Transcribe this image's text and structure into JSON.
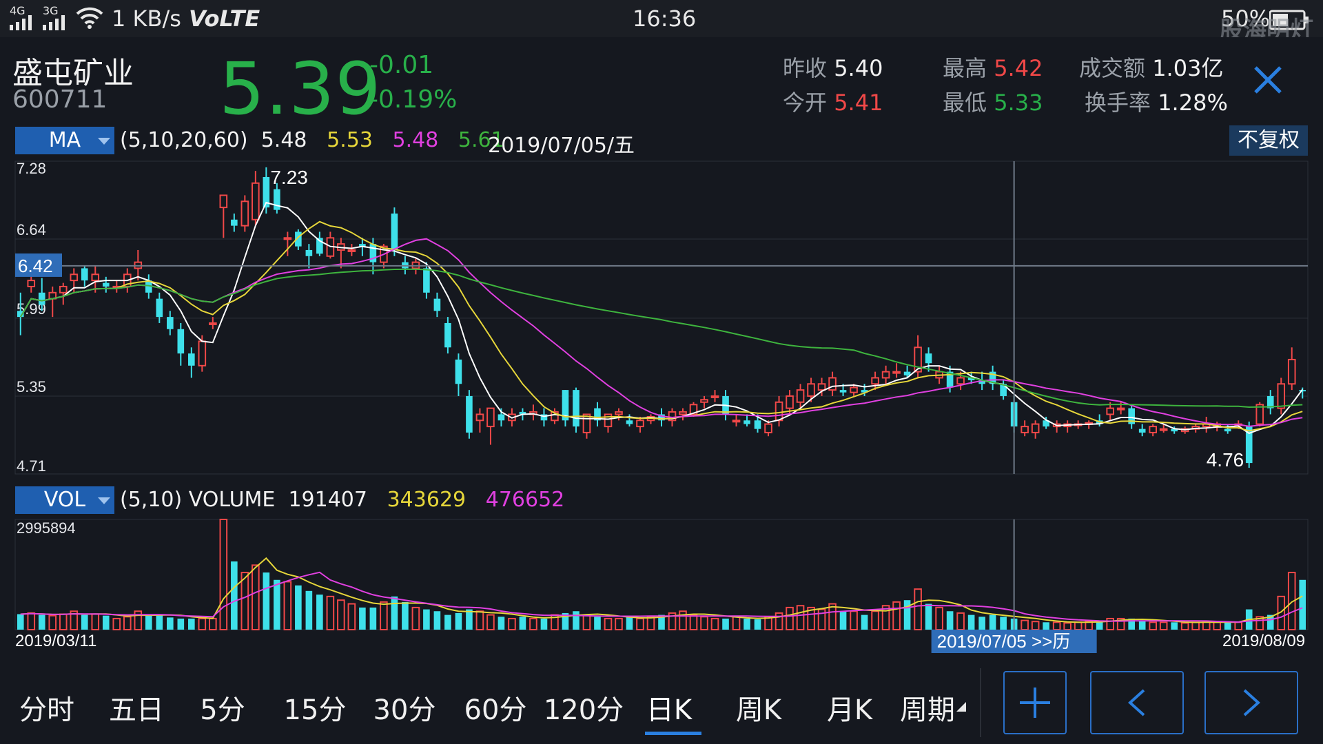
{
  "statusbar": {
    "signal1": "4G",
    "signal2": "3G",
    "speed": "1 KB/s",
    "volte": "VoLTE",
    "time": "16:36",
    "battery": "50%",
    "watermark": "股海明灯"
  },
  "stock": {
    "name": "盛屯矿业",
    "code": "600711",
    "price": "5.39",
    "change": "-0.01",
    "change_pct": "-0.19%"
  },
  "stats": {
    "prev_close_label": "昨收",
    "prev_close": "5.40",
    "open_label": "今开",
    "open": "5.41",
    "high_label": "最高",
    "high": "5.42",
    "low_label": "最低",
    "low": "5.33",
    "amount_label": "成交额",
    "amount": "1.03亿",
    "turnover_label": "换手率",
    "turnover": "1.28%"
  },
  "ma_panel": {
    "selector": "MA",
    "params": "(5,10,20,60)",
    "ma5": "5.48",
    "ma10": "5.53",
    "ma20": "5.48",
    "ma60": "5.61",
    "date": "2019/07/05/五",
    "adjust_button": "不复权",
    "y_labels": [
      "7.28",
      "6.64",
      "5.99",
      "5.35",
      "4.71"
    ],
    "crosshair_price": "6.42",
    "max_label": "7.23",
    "min_label": "4.76"
  },
  "vol_panel": {
    "selector": "VOL",
    "params": "(5,10) VOLUME",
    "volume": "191407",
    "ma5": "343629",
    "ma10": "476652",
    "max_label": "2995894",
    "start_date": "2019/03/11",
    "end_date": "2019/08/09",
    "cursor_date": "2019/07/05 >>历"
  },
  "colors": {
    "up": "#f04848",
    "down": "#3ee0ea",
    "ma5": "#ffffff",
    "ma10": "#e6d63a",
    "ma20": "#e040e0",
    "ma60": "#3eb43e",
    "accent": "#2a6fc7"
  },
  "tabs": [
    "分时",
    "五日",
    "5分",
    "15分",
    "30分",
    "60分",
    "120分",
    "日K",
    "周K",
    "月K",
    "周期"
  ],
  "active_tab": "日K",
  "chart_data": {
    "type": "candlestick",
    "price_range": [
      4.71,
      7.28
    ],
    "volume_max": 2995894,
    "candles": [
      [
        6.05,
        6.2,
        5.85,
        6.0
      ],
      [
        6.25,
        6.35,
        6.2,
        6.3
      ],
      [
        6.2,
        6.32,
        6.05,
        6.1
      ],
      [
        6.15,
        6.25,
        6.0,
        6.2
      ],
      [
        6.2,
        6.28,
        6.1,
        6.25
      ],
      [
        6.3,
        6.4,
        6.2,
        6.35
      ],
      [
        6.4,
        6.42,
        6.25,
        6.3
      ],
      [
        6.3,
        6.42,
        6.2,
        6.35
      ],
      [
        6.28,
        6.33,
        6.2,
        6.25
      ],
      [
        6.25,
        6.3,
        6.2,
        6.25
      ],
      [
        6.25,
        6.4,
        6.2,
        6.35
      ],
      [
        6.4,
        6.55,
        6.3,
        6.45
      ],
      [
        6.3,
        6.35,
        6.15,
        6.2
      ],
      [
        6.15,
        6.2,
        5.95,
        6.0
      ],
      [
        6.0,
        6.05,
        5.85,
        5.9
      ],
      [
        5.9,
        5.95,
        5.6,
        5.7
      ],
      [
        5.7,
        5.75,
        5.5,
        5.6
      ],
      [
        5.6,
        5.85,
        5.55,
        5.8
      ],
      [
        5.95,
        6.0,
        5.9,
        5.95
      ],
      [
        6.9,
        7.0,
        6.65,
        7.0
      ],
      [
        6.8,
        6.85,
        6.7,
        6.75
      ],
      [
        6.75,
        7.0,
        6.7,
        6.95
      ],
      [
        6.8,
        7.2,
        6.75,
        7.1
      ],
      [
        7.15,
        7.23,
        6.85,
        6.9
      ],
      [
        7.05,
        7.1,
        6.85,
        6.88
      ],
      [
        6.65,
        6.7,
        6.5,
        6.65
      ],
      [
        6.7,
        6.72,
        6.55,
        6.58
      ],
      [
        6.55,
        6.6,
        6.4,
        6.5
      ],
      [
        6.65,
        6.7,
        6.5,
        6.52
      ],
      [
        6.5,
        6.7,
        6.48,
        6.65
      ],
      [
        6.55,
        6.65,
        6.4,
        6.6
      ],
      [
        6.55,
        6.6,
        6.5,
        6.55
      ],
      [
        6.6,
        6.65,
        6.5,
        6.58
      ],
      [
        6.6,
        6.65,
        6.35,
        6.45
      ],
      [
        6.45,
        6.6,
        6.4,
        6.58
      ],
      [
        6.85,
        6.9,
        6.5,
        6.55
      ],
      [
        6.45,
        6.5,
        6.35,
        6.4
      ],
      [
        6.4,
        6.48,
        6.35,
        6.45
      ],
      [
        6.4,
        6.45,
        6.15,
        6.2
      ],
      [
        6.15,
        6.2,
        6.0,
        6.05
      ],
      [
        5.95,
        6.0,
        5.7,
        5.75
      ],
      [
        5.65,
        5.7,
        5.35,
        5.45
      ],
      [
        5.35,
        5.4,
        5.0,
        5.05
      ],
      [
        5.15,
        5.25,
        5.05,
        5.2
      ],
      [
        5.1,
        5.25,
        4.95,
        5.25
      ],
      [
        5.2,
        5.25,
        5.1,
        5.15
      ],
      [
        5.15,
        5.25,
        5.1,
        5.2
      ],
      [
        5.22,
        5.25,
        5.15,
        5.2
      ],
      [
        5.2,
        5.28,
        5.15,
        5.22
      ],
      [
        5.2,
        5.25,
        5.1,
        5.15
      ],
      [
        5.15,
        5.25,
        5.12,
        5.22
      ],
      [
        5.4,
        5.4,
        5.1,
        5.15
      ],
      [
        5.4,
        5.42,
        5.05,
        5.1
      ],
      [
        5.05,
        5.2,
        5.0,
        5.2
      ],
      [
        5.25,
        5.3,
        5.1,
        5.15
      ],
      [
        5.1,
        5.2,
        5.05,
        5.2
      ],
      [
        5.2,
        5.25,
        5.15,
        5.22
      ],
      [
        5.15,
        5.2,
        5.1,
        5.12
      ],
      [
        5.1,
        5.18,
        5.05,
        5.15
      ],
      [
        5.15,
        5.2,
        5.12,
        5.18
      ],
      [
        5.2,
        5.25,
        5.1,
        5.15
      ],
      [
        5.15,
        5.25,
        5.1,
        5.22
      ],
      [
        5.2,
        5.25,
        5.15,
        5.22
      ],
      [
        5.2,
        5.3,
        5.18,
        5.28
      ],
      [
        5.3,
        5.35,
        5.25,
        5.32
      ],
      [
        5.35,
        5.4,
        5.3,
        5.35
      ],
      [
        5.35,
        5.4,
        5.15,
        5.2
      ],
      [
        5.15,
        5.2,
        5.1,
        5.15
      ],
      [
        5.15,
        5.2,
        5.1,
        5.12
      ],
      [
        5.15,
        5.2,
        5.05,
        5.08
      ],
      [
        5.05,
        5.15,
        5.02,
        5.12
      ],
      [
        5.15,
        5.35,
        5.1,
        5.3
      ],
      [
        5.25,
        5.4,
        5.2,
        5.35
      ],
      [
        5.3,
        5.45,
        5.25,
        5.4
      ],
      [
        5.35,
        5.5,
        5.3,
        5.45
      ],
      [
        5.4,
        5.5,
        5.35,
        5.45
      ],
      [
        5.4,
        5.55,
        5.35,
        5.5
      ],
      [
        5.4,
        5.45,
        5.35,
        5.38
      ],
      [
        5.38,
        5.45,
        5.35,
        5.42
      ],
      [
        5.4,
        5.45,
        5.35,
        5.38
      ],
      [
        5.45,
        5.55,
        5.4,
        5.5
      ],
      [
        5.5,
        5.6,
        5.45,
        5.55
      ],
      [
        5.55,
        5.62,
        5.5,
        5.55
      ],
      [
        5.55,
        5.6,
        5.5,
        5.52
      ],
      [
        5.55,
        5.85,
        5.5,
        5.75
      ],
      [
        5.7,
        5.75,
        5.55,
        5.62
      ],
      [
        5.5,
        5.6,
        5.45,
        5.55
      ],
      [
        5.55,
        5.6,
        5.38,
        5.42
      ],
      [
        5.45,
        5.55,
        5.4,
        5.5
      ],
      [
        5.5,
        5.55,
        5.45,
        5.48
      ],
      [
        5.48,
        5.55,
        5.4,
        5.45
      ],
      [
        5.55,
        5.6,
        5.4,
        5.45
      ],
      [
        5.45,
        5.48,
        5.32,
        5.35
      ],
      [
        5.3,
        5.35,
        5.05,
        5.1
      ],
      [
        5.05,
        5.15,
        5.02,
        5.1
      ],
      [
        5.05,
        5.15,
        5.0,
        5.12
      ],
      [
        5.15,
        5.18,
        5.08,
        5.1
      ],
      [
        5.1,
        5.15,
        5.05,
        5.12
      ],
      [
        5.1,
        5.15,
        5.05,
        5.12
      ],
      [
        5.12,
        5.15,
        5.08,
        5.12
      ],
      [
        5.12,
        5.15,
        5.08,
        5.13
      ],
      [
        5.15,
        5.2,
        5.1,
        5.12
      ],
      [
        5.2,
        5.3,
        5.15,
        5.25
      ],
      [
        5.25,
        5.3,
        5.2,
        5.25
      ],
      [
        5.25,
        5.28,
        5.08,
        5.12
      ],
      [
        5.08,
        5.12,
        5.02,
        5.05
      ],
      [
        5.05,
        5.12,
        5.02,
        5.1
      ],
      [
        5.08,
        5.12,
        5.05,
        5.08
      ],
      [
        5.08,
        5.1,
        5.04,
        5.06
      ],
      [
        5.06,
        5.1,
        5.04,
        5.08
      ],
      [
        5.08,
        5.12,
        5.05,
        5.1
      ],
      [
        5.1,
        5.18,
        5.05,
        5.12
      ],
      [
        5.1,
        5.14,
        5.06,
        5.12
      ],
      [
        5.08,
        5.12,
        5.04,
        5.06
      ],
      [
        5.12,
        5.15,
        5.08,
        5.12
      ],
      [
        5.1,
        5.14,
        4.76,
        4.8
      ],
      [
        5.12,
        5.3,
        5.1,
        5.28
      ],
      [
        5.35,
        5.4,
        5.2,
        5.25
      ],
      [
        5.25,
        5.5,
        5.2,
        5.45
      ],
      [
        5.45,
        5.75,
        5.4,
        5.65
      ],
      [
        5.4,
        5.42,
        5.33,
        5.39
      ]
    ],
    "volumes": [
      0.42,
      0.45,
      0.4,
      0.38,
      0.42,
      0.5,
      0.4,
      0.42,
      0.38,
      0.3,
      0.35,
      0.5,
      0.42,
      0.4,
      0.33,
      0.3,
      0.3,
      0.3,
      0.3,
      2.99,
      1.85,
      1.55,
      1.75,
      1.55,
      1.35,
      1.3,
      1.2,
      1.05,
      0.95,
      0.9,
      0.8,
      0.7,
      0.6,
      0.6,
      0.75,
      0.9,
      0.75,
      0.6,
      0.55,
      0.5,
      0.4,
      0.45,
      0.55,
      0.5,
      0.4,
      0.35,
      0.3,
      0.35,
      0.3,
      0.3,
      0.4,
      0.45,
      0.5,
      0.4,
      0.35,
      0.3,
      0.3,
      0.35,
      0.3,
      0.35,
      0.4,
      0.45,
      0.5,
      0.4,
      0.35,
      0.3,
      0.3,
      0.35,
      0.3,
      0.28,
      0.35,
      0.45,
      0.6,
      0.65,
      0.6,
      0.55,
      0.7,
      0.5,
      0.5,
      0.4,
      0.5,
      0.65,
      0.75,
      0.8,
      1.1,
      0.7,
      0.6,
      0.5,
      0.45,
      0.4,
      0.35,
      0.4,
      0.35,
      0.3,
      0.25,
      0.22,
      0.2,
      0.2,
      0.18,
      0.2,
      0.22,
      0.25,
      0.3,
      0.3,
      0.3,
      0.25,
      0.2,
      0.2,
      0.2,
      0.18,
      0.2,
      0.22,
      0.2,
      0.2,
      0.2,
      0.55,
      0.35,
      0.4,
      0.9,
      1.55,
      1.35
    ]
  }
}
